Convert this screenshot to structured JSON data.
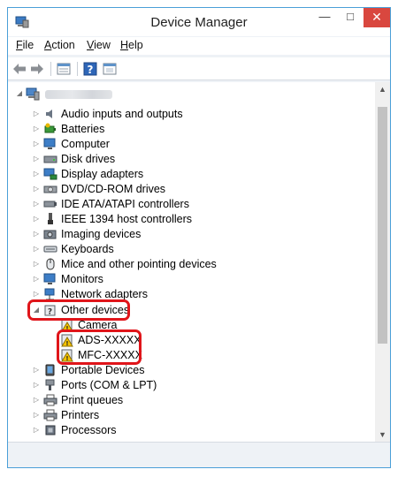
{
  "window": {
    "title": "Device Manager",
    "controls": {
      "minimize": "—",
      "maximize": "□",
      "close": "✕"
    }
  },
  "menu": [
    {
      "key": "F",
      "rest": "ile"
    },
    {
      "key": "A",
      "rest": "ction"
    },
    {
      "key": "V",
      "rest": "iew"
    },
    {
      "key": "H",
      "rest": "elp"
    }
  ],
  "toolbar": {
    "icons": [
      "back-arrow-icon",
      "forward-arrow-icon",
      "properties-icon",
      "help-icon",
      "update-driver-icon"
    ]
  },
  "tree": {
    "root_icon": "computer-icon",
    "items": [
      {
        "label": "Audio inputs and outputs",
        "icon": "speaker-icon"
      },
      {
        "label": "Batteries",
        "icon": "battery-icon"
      },
      {
        "label": "Computer",
        "icon": "monitor-icon"
      },
      {
        "label": "Disk drives",
        "icon": "disk-drive-icon"
      },
      {
        "label": "Display adapters",
        "icon": "display-adapter-icon"
      },
      {
        "label": "DVD/CD-ROM drives",
        "icon": "optical-drive-icon"
      },
      {
        "label": "IDE ATA/ATAPI controllers",
        "icon": "controller-icon"
      },
      {
        "label": "IEEE 1394 host controllers",
        "icon": "ieee1394-icon"
      },
      {
        "label": "Imaging devices",
        "icon": "camera-icon"
      },
      {
        "label": "Keyboards",
        "icon": "keyboard-icon"
      },
      {
        "label": "Mice and other pointing devices",
        "icon": "mouse-icon"
      },
      {
        "label": "Monitors",
        "icon": "monitor-icon"
      },
      {
        "label": "Network adapters",
        "icon": "network-icon"
      },
      {
        "label": "Other devices",
        "icon": "unknown-device-icon",
        "expanded": true,
        "children": [
          {
            "label": "Camera",
            "icon": "warning-device-icon"
          },
          {
            "label": "ADS-XXXXX",
            "icon": "warning-device-icon"
          },
          {
            "label": "MFC-XXXXX",
            "icon": "warning-device-icon"
          }
        ]
      },
      {
        "label": "Portable Devices",
        "icon": "portable-device-icon"
      },
      {
        "label": "Ports (COM & LPT)",
        "icon": "port-icon"
      },
      {
        "label": "Print queues",
        "icon": "printer-icon"
      },
      {
        "label": "Printers",
        "icon": "printer-icon"
      },
      {
        "label": "Processors",
        "icon": "processor-icon"
      }
    ]
  },
  "colors": {
    "highlight": "#e0151a",
    "close_button": "#d9473f",
    "accent": "#4a9fd8"
  }
}
